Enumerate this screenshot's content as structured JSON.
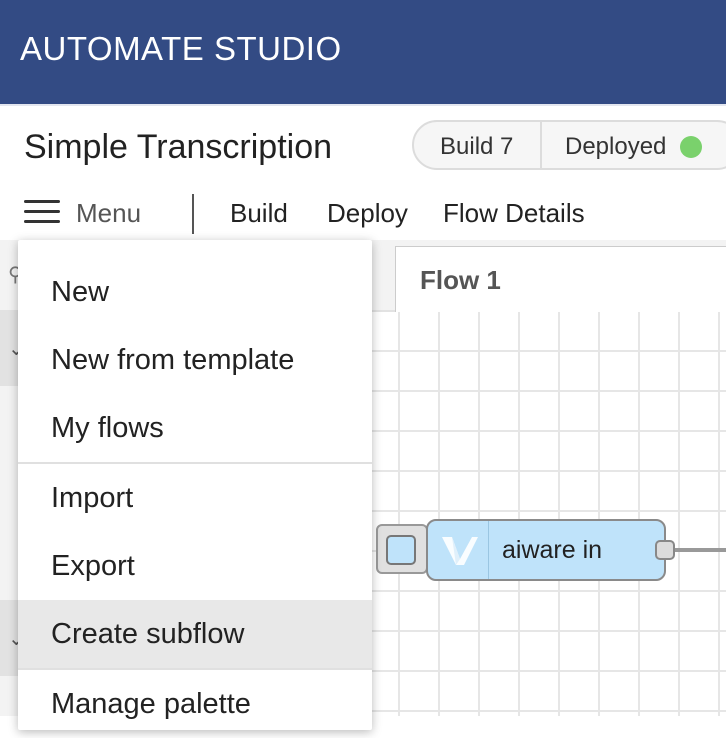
{
  "app": {
    "brand": "AUTOMATE STUDIO"
  },
  "header": {
    "flow_title": "Simple Transcription",
    "build_label": "Build 7",
    "deploy_status": "Deployed",
    "status_color": "#7ad16c"
  },
  "menubar": {
    "menu_label": "Menu",
    "items": [
      "Build",
      "Deploy",
      "Flow Details"
    ]
  },
  "tabs": [
    {
      "label": "Flow 1"
    }
  ],
  "node": {
    "label": "aiware in",
    "color": "#bfe3fa",
    "icon": "aiware-logo-icon"
  },
  "menu": {
    "items": [
      {
        "label": "New"
      },
      {
        "label": "New from template"
      },
      {
        "label": "My flows"
      },
      {
        "label": "Import"
      },
      {
        "label": "Export"
      },
      {
        "label": "Create subflow",
        "hovered": true
      },
      {
        "label": "Manage palette"
      }
    ]
  },
  "colors": {
    "topbar": "#334b84",
    "canvas_grid": "#e6e6e6",
    "menu_hover": "#e8e8e8"
  }
}
